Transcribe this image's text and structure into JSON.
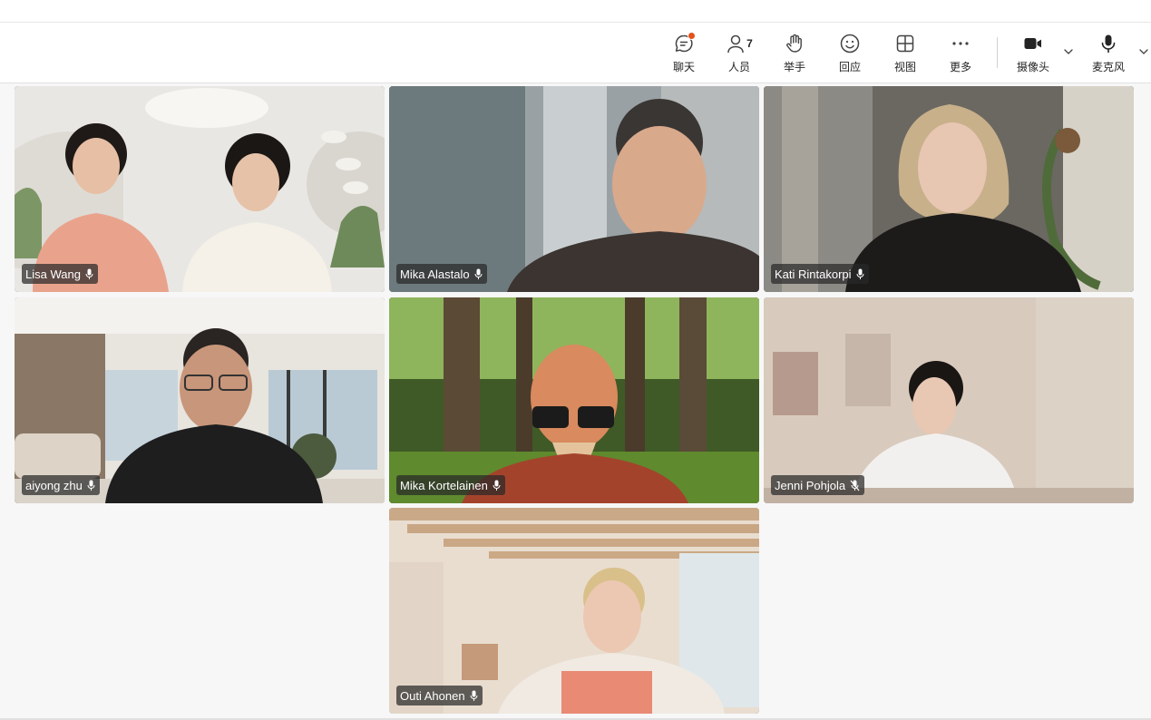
{
  "toolbar": {
    "chat_label": "聊天",
    "people_label": "人员",
    "people_count": "7",
    "raise_hand_label": "举手",
    "react_label": "回应",
    "view_label": "视图",
    "more_label": "更多",
    "camera_label": "摄像头",
    "mic_label": "麦克风"
  },
  "participants": [
    {
      "name": "Lisa Wang",
      "mic": "on"
    },
    {
      "name": "Mika Alastalo",
      "mic": "on"
    },
    {
      "name": "Kati Rintakorpi",
      "mic": "on"
    },
    {
      "name": "aiyong zhu",
      "mic": "on",
      "speaking": true
    },
    {
      "name": "Mika Kortelainen",
      "mic": "on"
    },
    {
      "name": "Jenni Pohjola",
      "mic": "muted"
    },
    {
      "name": "Outi Ahonen",
      "mic": "on"
    }
  ],
  "colors": {
    "accent": "#5b5fc7",
    "notification": "#e2521a"
  }
}
